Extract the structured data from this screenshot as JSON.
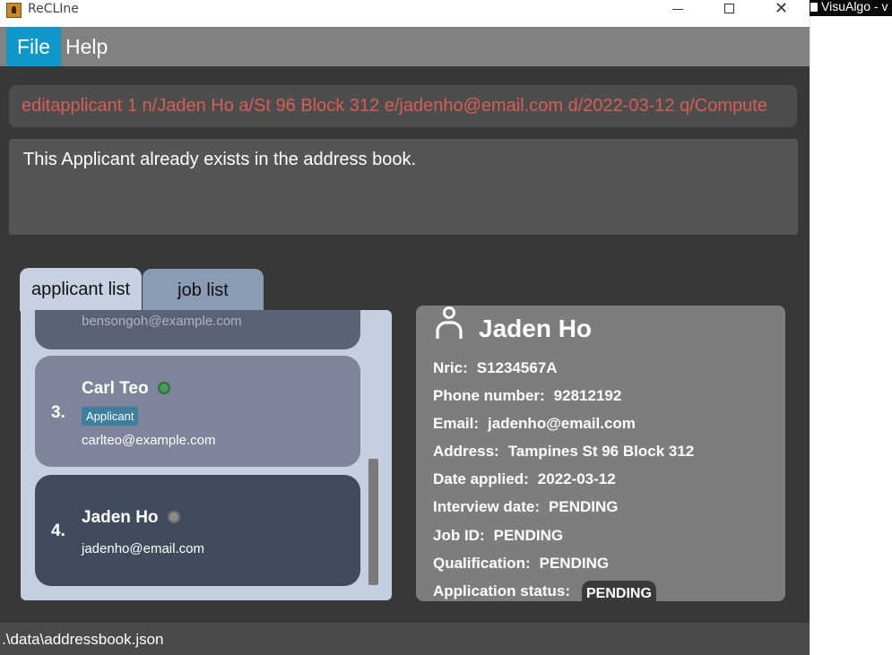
{
  "window": {
    "title": "ReCLIne",
    "controls": {
      "minimize": "minimize",
      "maximize": "maximize",
      "close": "close"
    }
  },
  "menu": {
    "items": [
      "File",
      "Help"
    ]
  },
  "command_box": {
    "value": "editapplicant 1 n/Jaden Ho a/St 96 Block 312 e/jadenho@email.com d/2022-03-12 q/Compute"
  },
  "result": {
    "message": "This Applicant already exists in the address book."
  },
  "tabs": [
    {
      "label": "applicant list",
      "selected": true
    },
    {
      "label": "job list",
      "selected": false
    }
  ],
  "applicant_list": {
    "partial_top_email": "bensongoh@example.com",
    "cards": [
      {
        "index": "3.",
        "name": "Carl Teo",
        "status_color": "#4a9a5a",
        "tag": "Applicant",
        "email": "carlteo@example.com"
      },
      {
        "index": "4.",
        "name": "Jaden Ho",
        "status_color": "#8a8a8a",
        "email": "jadenho@email.com"
      }
    ]
  },
  "details": {
    "name": "Jaden Ho",
    "icon": "person-icon",
    "fields": [
      {
        "label": "Nric:",
        "value": "S1234567A"
      },
      {
        "label": "Phone number:",
        "value": "92812192"
      },
      {
        "label": "Email:",
        "value": "jadenho@email.com"
      },
      {
        "label": "Address:",
        "value": "Tampines St 96 Block 312"
      },
      {
        "label": "Date applied:",
        "value": "2022-03-12"
      },
      {
        "label": "Interview date:",
        "value": "PENDING"
      },
      {
        "label": "Job ID:",
        "value": "PENDING"
      },
      {
        "label": "Qualification:",
        "value": "PENDING"
      },
      {
        "label": "Application status:",
        "value": "PENDING"
      }
    ]
  },
  "status_bar": {
    "path": ".\\data\\addressbook.json"
  },
  "background_window": {
    "title": "VisuAlgo - v"
  },
  "colors": {
    "accent": "#0e97c9",
    "command_text": "#d65d56",
    "tag": "#3e7fa0"
  }
}
